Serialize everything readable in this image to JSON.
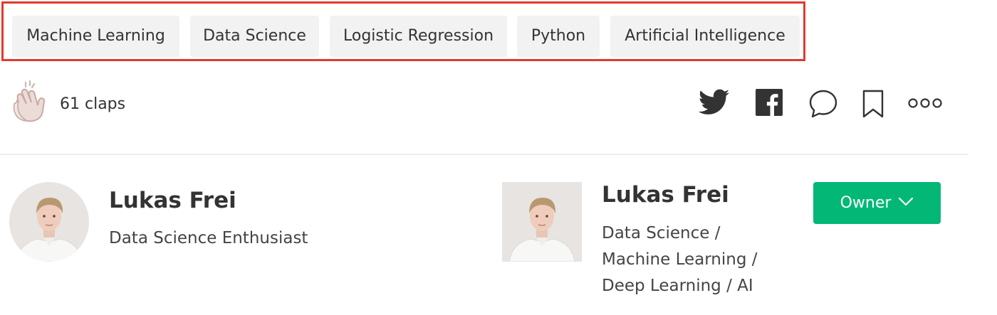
{
  "tags": [
    {
      "label": "Machine Learning"
    },
    {
      "label": "Data Science"
    },
    {
      "label": "Logistic Regression"
    },
    {
      "label": "Python"
    },
    {
      "label": "Artificial Intelligence"
    }
  ],
  "claps": {
    "count_label": "61 claps",
    "icon": "clap-icon"
  },
  "share_icons": [
    "twitter-icon",
    "facebook-icon",
    "comment-icon",
    "bookmark-icon",
    "more-icon"
  ],
  "author_card": {
    "name": "Lukas Frei",
    "bio": "Data Science Enthusiast"
  },
  "author_profile": {
    "name": "Lukas Frei",
    "bio_lines": [
      "Data Science /",
      "Machine Learning /",
      "Deep Learning / AI"
    ],
    "owner_button_label": "Owner"
  },
  "colors": {
    "highlight_border": "#e03a2f",
    "tag_background": "#f2f2f2",
    "owner_button": "#03b876",
    "icon_color": "#333333"
  }
}
